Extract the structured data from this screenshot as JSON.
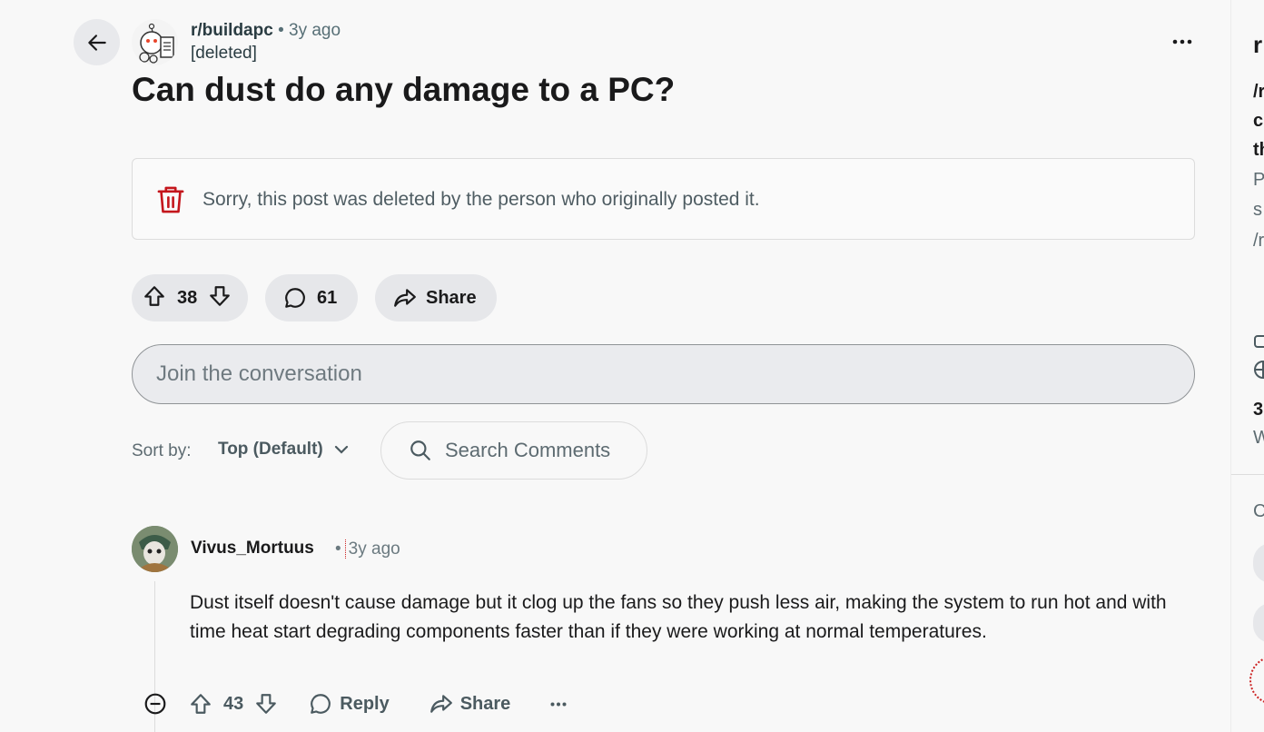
{
  "post": {
    "subreddit": "r/buildapc",
    "age": "• 3y ago",
    "author": "[deleted]",
    "title": "Can dust do any damage to a PC?",
    "deleted_message": "Sorry, this post was deleted by the person who originally posted it.",
    "votes": "38",
    "comments": "61",
    "share_label": "Share"
  },
  "composer": {
    "placeholder": "Join the conversation"
  },
  "sort": {
    "label": "Sort by:",
    "selected": "Top (Default)"
  },
  "search": {
    "placeholder": "Search Comments"
  },
  "comment": {
    "author": "Vivus_Mortuus",
    "dot": "•",
    "age": "3y ago",
    "body": "Dust itself doesn't cause damage but it clog up the fans so they push less air, making the system to run hot and with time heat start degrading components faster than if they were working at normal temperatures.",
    "votes": "43",
    "reply_label": "Reply",
    "share_label": "Share"
  },
  "right_panel": {
    "lines": [
      "r",
      "/r",
      "c",
      "th",
      "P",
      "s",
      "/r",
      "3",
      "W",
      "C"
    ]
  },
  "colors": {
    "trash": "#c4161c",
    "accent": "#ff4500"
  },
  "icons": [
    "back-arrow-icon",
    "snoo-icon",
    "more-icon",
    "trash-icon",
    "upvote-icon",
    "downvote-icon",
    "comment-icon",
    "share-icon",
    "search-icon",
    "chevron-down-icon",
    "collapse-icon"
  ]
}
